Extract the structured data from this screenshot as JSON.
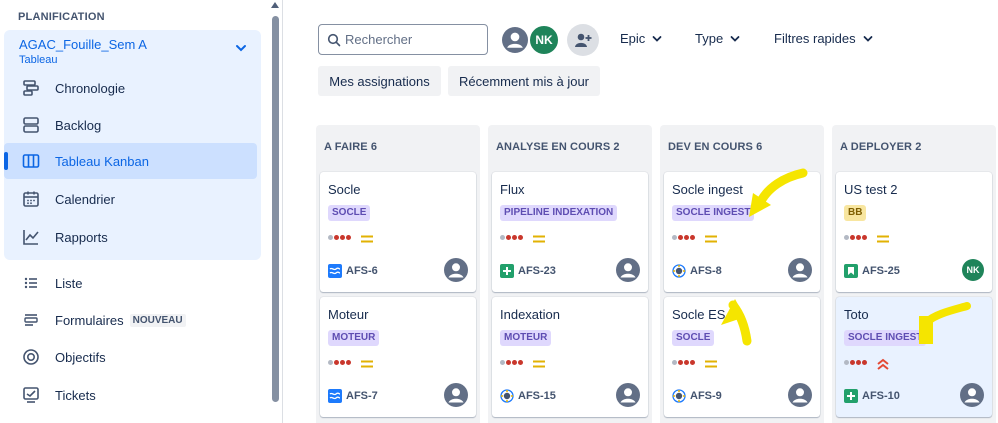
{
  "sidebar": {
    "section_title": "PLANIFICATION",
    "project": {
      "name": "AGAC_Fouille_Sem A",
      "subtitle": "Tableau"
    },
    "project_items": [
      {
        "label": "Chronologie",
        "icon": "timeline-icon"
      },
      {
        "label": "Backlog",
        "icon": "backlog-icon"
      },
      {
        "label": "Tableau Kanban",
        "icon": "board-icon",
        "active": true
      },
      {
        "label": "Calendrier",
        "icon": "calendar-icon"
      },
      {
        "label": "Rapports",
        "icon": "reports-icon"
      }
    ],
    "other_items": [
      {
        "label": "Liste",
        "icon": "list-icon"
      },
      {
        "label": "Formulaires",
        "icon": "forms-icon",
        "badge": "NOUVEAU"
      },
      {
        "label": "Objectifs",
        "icon": "goals-icon"
      },
      {
        "label": "Tickets",
        "icon": "tickets-icon"
      }
    ]
  },
  "toolbar": {
    "search_placeholder": "Rechercher",
    "avatar_initials": "NK",
    "filters": [
      "Epic",
      "Type",
      "Filtres rapides"
    ],
    "quick_buttons": [
      "Mes assignations",
      "Récemment mis à jour"
    ]
  },
  "colors": {
    "accent": "#0c66e4",
    "label_purple_bg": "#dfd8fd",
    "label_purple_text": "#5e4db2",
    "label_yellow_bg": "#f8e6a0",
    "priority_medium": "#e2b203",
    "priority_high": "#e34935",
    "story_green": "#22a06b",
    "task_blue": "#1d7afc",
    "annotation_arrow": "#f5e500"
  },
  "columns": [
    {
      "title": "A FAIRE 6",
      "cards": [
        {
          "title": "Socle",
          "label": "SOCLE",
          "label_style": "purple",
          "priority": "medium",
          "type": "epic-wave",
          "key": "AFS-6",
          "assignee": "user"
        },
        {
          "title": "Moteur",
          "label": "MOTEUR",
          "label_style": "purple",
          "priority": "medium",
          "type": "epic-wave",
          "key": "AFS-7",
          "assignee": "user"
        }
      ]
    },
    {
      "title": "ANALYSE EN COURS 2",
      "cards": [
        {
          "title": "Flux",
          "label": "PIPELINE INDEXATION",
          "label_style": "purple",
          "priority": "medium",
          "type": "add",
          "key": "AFS-23",
          "assignee": "user"
        },
        {
          "title": "Indexation",
          "label": "MOTEUR",
          "label_style": "purple",
          "priority": "medium",
          "type": "gear",
          "key": "AFS-15",
          "assignee": "user"
        }
      ]
    },
    {
      "title": "DEV EN COURS 6",
      "cards": [
        {
          "title": "Socle ingest",
          "label": "SOCLE INGEST",
          "label_style": "purple",
          "priority": "medium",
          "type": "gear",
          "key": "AFS-8",
          "assignee": "user"
        },
        {
          "title": "Socle ES",
          "label": "SOCLE",
          "label_style": "purple",
          "priority": "medium",
          "type": "gear",
          "key": "AFS-9",
          "assignee": "user"
        }
      ]
    },
    {
      "title": "A DEPLOYER 2",
      "cards": [
        {
          "title": "US test 2",
          "label": "BB",
          "label_style": "yellow",
          "priority": "medium",
          "type": "story",
          "key": "AFS-25",
          "assignee": "NK"
        },
        {
          "title": "Toto",
          "label": "SOCLE INGEST",
          "label_style": "purple",
          "priority": "high",
          "type": "add",
          "key": "AFS-10",
          "assignee": "user",
          "highlight": true
        }
      ]
    }
  ]
}
